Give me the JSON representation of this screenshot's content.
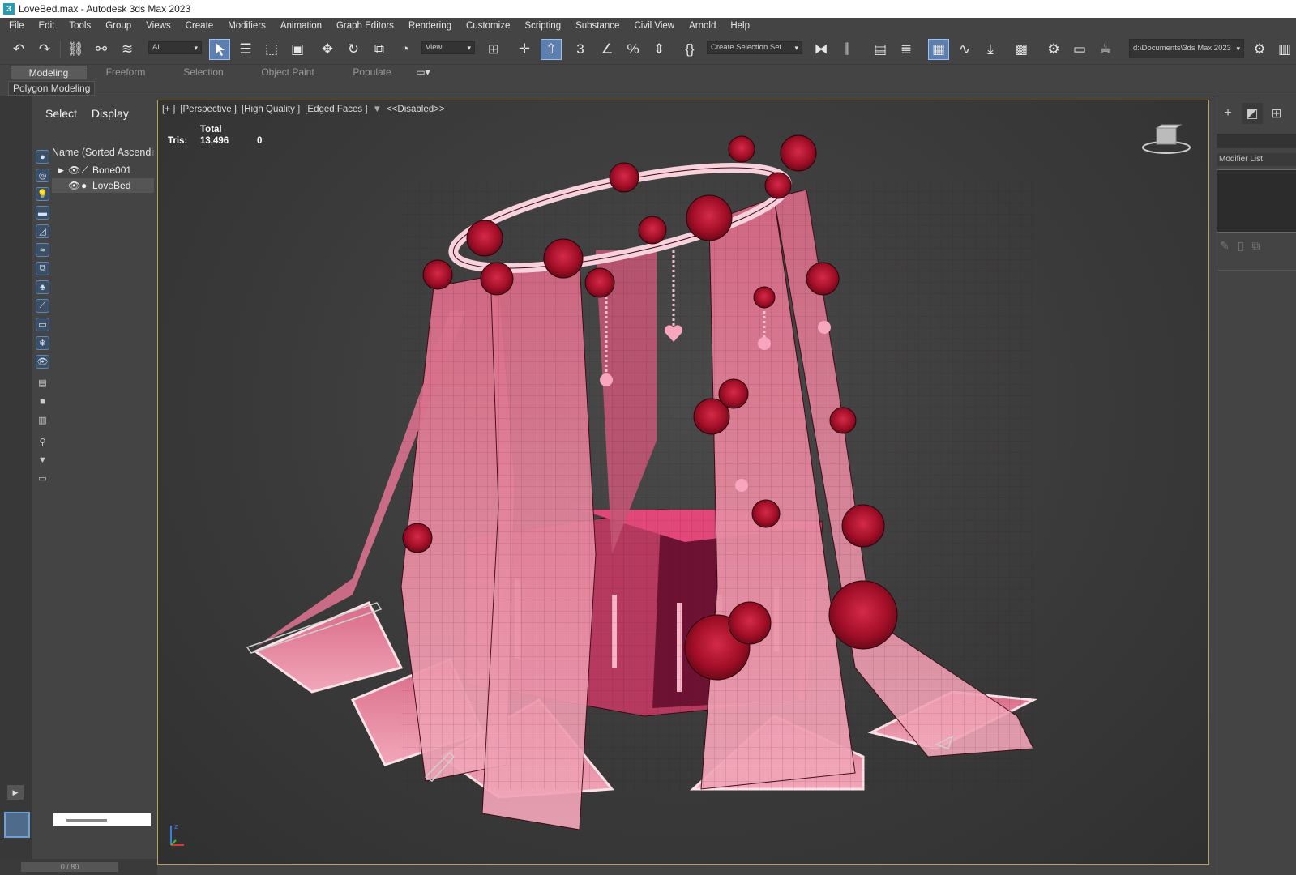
{
  "window": {
    "title": "LoveBed.max - Autodesk 3ds Max 2023",
    "app_icon": "3"
  },
  "menu": [
    "File",
    "Edit",
    "Tools",
    "Group",
    "Views",
    "Create",
    "Modifiers",
    "Animation",
    "Graph Editors",
    "Rendering",
    "Customize",
    "Scripting",
    "Substance",
    "Civil View",
    "Arnold",
    "Help"
  ],
  "toolbar": {
    "selection_filter": "All",
    "reference_coord": "View",
    "named_selection_set": "Create Selection Set",
    "project_path": "d:\\Documents\\3ds Max 2023"
  },
  "ribbon": {
    "tabs": [
      "Modeling",
      "Freeform",
      "Selection",
      "Object Paint",
      "Populate"
    ],
    "active_tab": "Modeling",
    "sub_panel": "Polygon Modeling"
  },
  "explorer": {
    "tabs": [
      "Select",
      "Display"
    ],
    "column_header": "Name (Sorted Ascending)",
    "items": [
      {
        "name": "Bone001"
      },
      {
        "name": "LoveBed"
      }
    ]
  },
  "viewport": {
    "label_parts": [
      "[+ ]",
      "[Perspective ]",
      "[High Quality ]",
      "[Edged Faces ]"
    ],
    "filter_label": "<<Disabled>>",
    "stats_header": "Total",
    "stats": {
      "key": "Tris:",
      "total": "13,496",
      "selected": "0"
    }
  },
  "timeline": {
    "frame": "0 / 80"
  },
  "command_panel": {
    "modifier_list": "Modifier List"
  },
  "colors": {
    "ui_bg": "#444444",
    "viewport_border": "#b8a257",
    "accent": "#5d7fb0",
    "fabric": "#e77e98",
    "roses": "#b0142e"
  }
}
